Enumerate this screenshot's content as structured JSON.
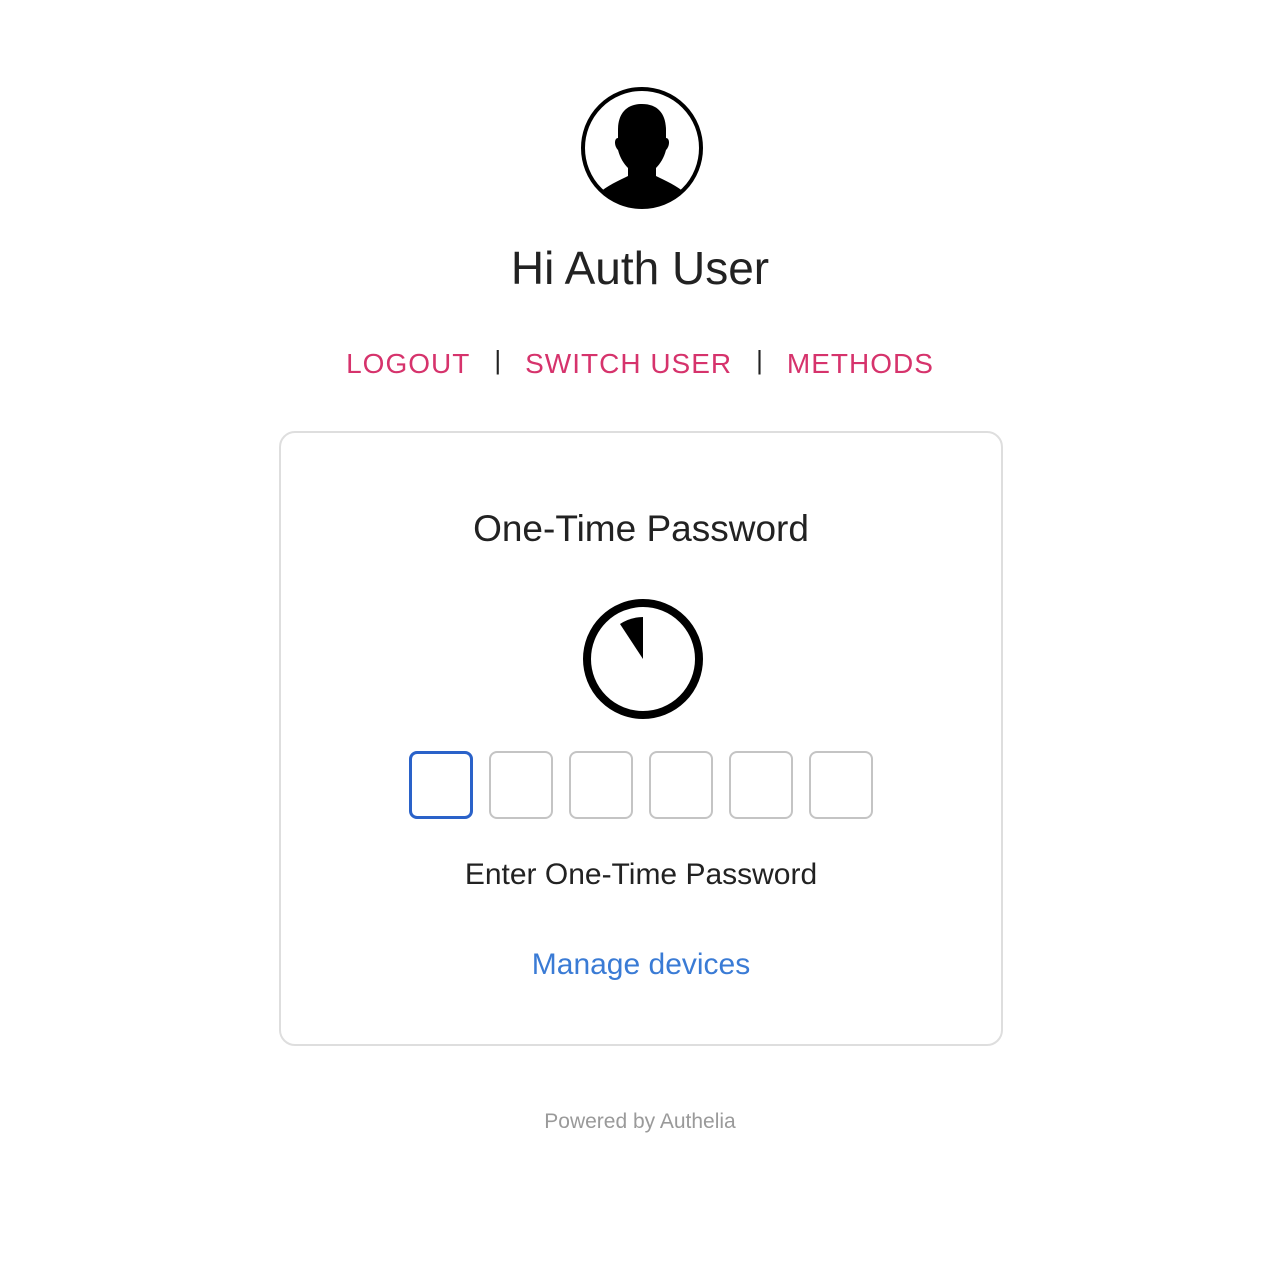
{
  "header": {
    "avatar_icon": "user-silhouette-icon",
    "greeting": "Hi Auth User"
  },
  "nav": {
    "logout_label": "LOGOUT",
    "switch_user_label": "SWITCH USER",
    "methods_label": "METHODS",
    "separator": "|"
  },
  "card": {
    "title": "One-Time Password",
    "timer_icon": "countdown-timer-icon",
    "otp_digits": [
      "",
      "",
      "",
      "",
      "",
      ""
    ],
    "otp_label": "Enter One-Time Password",
    "manage_devices_label": "Manage devices"
  },
  "footer": {
    "text": "Powered by Authelia"
  },
  "colors": {
    "nav_link": "#d6336c",
    "focus_border": "#2a62c9",
    "link": "#3a7bd5",
    "footer_text": "#9a9a9a"
  }
}
